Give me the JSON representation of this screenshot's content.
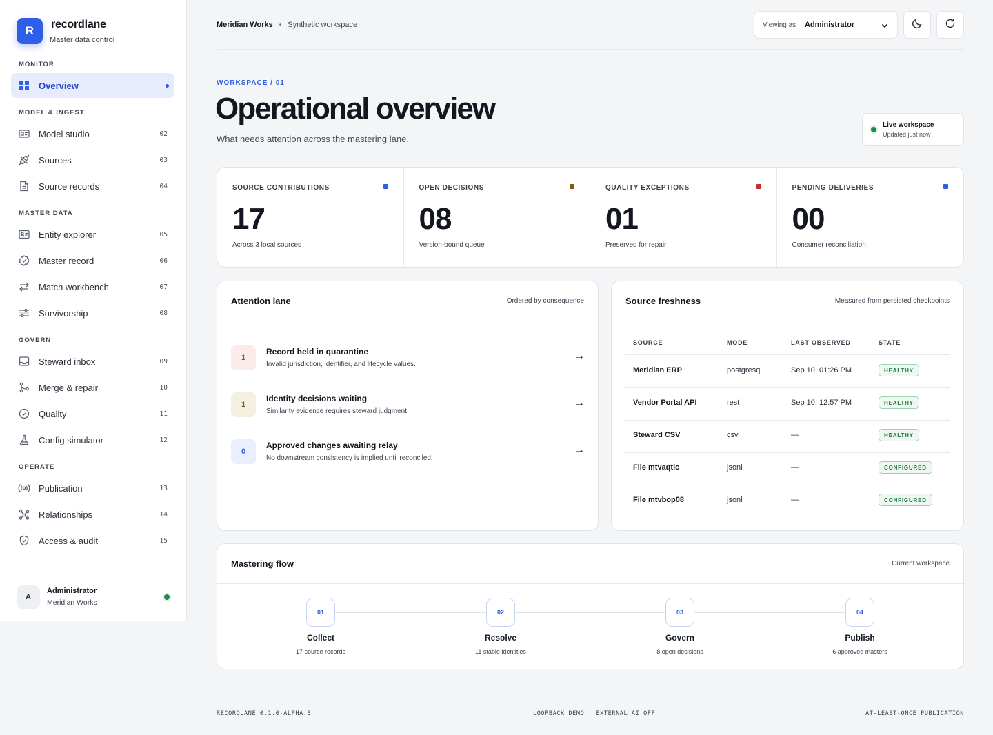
{
  "brand": {
    "logo_letter": "R",
    "name": "recordlane",
    "subtitle": "Master data control"
  },
  "nav": {
    "sections": [
      "MONITOR",
      "MODEL & INGEST",
      "MASTER DATA",
      "GOVERN",
      "OPERATE"
    ],
    "items": [
      {
        "label": "Overview",
        "icon": "grid-icon",
        "active": true
      },
      {
        "label": "Model studio",
        "num": "02",
        "icon": "id-card-icon"
      },
      {
        "label": "Sources",
        "num": "03",
        "icon": "plug-icon"
      },
      {
        "label": "Source records",
        "num": "04",
        "icon": "document-icon"
      },
      {
        "label": "Entity explorer",
        "num": "05",
        "icon": "contact-card-icon"
      },
      {
        "label": "Master record",
        "num": "06",
        "icon": "badge-check-icon"
      },
      {
        "label": "Match workbench",
        "num": "07",
        "icon": "swap-arrows-icon"
      },
      {
        "label": "Survivorship",
        "num": "08",
        "icon": "sliders-icon"
      },
      {
        "label": "Steward inbox",
        "num": "09",
        "icon": "inbox-icon"
      },
      {
        "label": "Merge & repair",
        "num": "10",
        "icon": "git-merge-icon"
      },
      {
        "label": "Quality",
        "num": "11",
        "icon": "check-circle-icon"
      },
      {
        "label": "Config simulator",
        "num": "12",
        "icon": "flask-icon"
      },
      {
        "label": "Publication",
        "num": "13",
        "icon": "broadcast-icon"
      },
      {
        "label": "Relationships",
        "num": "14",
        "icon": "network-icon"
      },
      {
        "label": "Access & audit",
        "num": "15",
        "icon": "shield-check-icon"
      }
    ]
  },
  "user": {
    "initial": "A",
    "name": "Administrator",
    "org": "Meridian Works"
  },
  "topbar": {
    "org": "Meridian Works",
    "separator": "•",
    "workspace": "Synthetic workspace",
    "viewing_label": "Viewing as",
    "viewing_value": "Administrator"
  },
  "header": {
    "eyebrow": "WORKSPACE / 01",
    "title": "Operational overview",
    "subtitle": "What needs attention across the mastering lane.",
    "live_title": "Live workspace",
    "live_sub": "Updated just now"
  },
  "metrics": [
    {
      "label": "SOURCE CONTRIBUTIONS",
      "value": "17",
      "sub": "Across 3 local sources",
      "color": "#2f5ee8"
    },
    {
      "label": "OPEN DECISIONS",
      "value": "08",
      "sub": "Version-bound queue",
      "color": "#8a5a12"
    },
    {
      "label": "QUALITY EXCEPTIONS",
      "value": "01",
      "sub": "Preserved for repair",
      "color": "#c2302b"
    },
    {
      "label": "PENDING DELIVERIES",
      "value": "00",
      "sub": "Consumer reconciliation",
      "color": "#2f5ee8"
    }
  ],
  "attention": {
    "title": "Attention lane",
    "meta": "Ordered by consequence",
    "items": [
      {
        "count": "1",
        "title": "Record held in quarantine",
        "desc": "Invalid jurisdiction, identifier, and lifecycle values.",
        "arrow": "→",
        "badge_bg": "#fbeceb",
        "badge_fg": "#b23a30"
      },
      {
        "count": "1",
        "title": "Identity decisions waiting",
        "desc": "Similarity evidence requires steward judgment.",
        "arrow": "→",
        "badge_bg": "#f4efe3",
        "badge_fg": "#7a5614"
      },
      {
        "count": "0",
        "title": "Approved changes awaiting relay",
        "desc": "No downstream consistency is implied until reconciled.",
        "arrow": "→",
        "badge_bg": "#eaeffd",
        "badge_fg": "#2f5ee8"
      }
    ]
  },
  "freshness": {
    "title": "Source freshness",
    "meta": "Measured from persisted checkpoints",
    "columns": [
      "SOURCE",
      "MODE",
      "LAST OBSERVED",
      "STATE"
    ],
    "rows": [
      {
        "source": "Meridian ERP",
        "mode": "postgresql",
        "observed": "Sep 10, 01:26 PM",
        "state": "HEALTHY"
      },
      {
        "source": "Vendor Portal API",
        "mode": "rest",
        "observed": "Sep 10, 12:57 PM",
        "state": "HEALTHY"
      },
      {
        "source": "Steward CSV",
        "mode": "csv",
        "observed": "—",
        "state": "HEALTHY"
      },
      {
        "source": "File mtvaqtlc",
        "mode": "jsonl",
        "observed": "—",
        "state": "CONFIGURED"
      },
      {
        "source": "File mtvbop08",
        "mode": "jsonl",
        "observed": "—",
        "state": "CONFIGURED"
      }
    ]
  },
  "flow": {
    "title": "Mastering flow",
    "meta": "Current workspace",
    "steps": [
      {
        "num": "01",
        "name": "Collect",
        "sub": "17 source records"
      },
      {
        "num": "02",
        "name": "Resolve",
        "sub": "11 stable identities"
      },
      {
        "num": "03",
        "name": "Govern",
        "sub": "8 open decisions"
      },
      {
        "num": "04",
        "name": "Publish",
        "sub": "6 approved masters"
      }
    ]
  },
  "footer": {
    "left": "RECORDLANE 0.1.0-ALPHA.3",
    "center": "LOOPBACK DEMO · EXTERNAL AI OFF",
    "right": "AT-LEAST-ONCE PUBLICATION"
  },
  "colors": {
    "accent": "#2f5ee8",
    "healthy": "#1f7a45",
    "live": "#1f8a4c"
  }
}
